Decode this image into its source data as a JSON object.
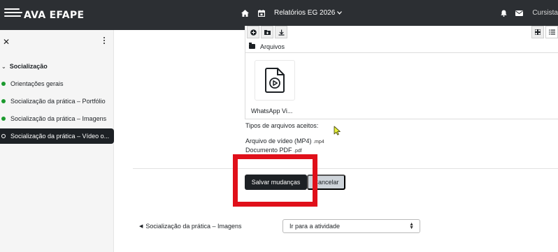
{
  "navbar": {
    "brand": "AVA EFAPE",
    "menu_label": "Relatórios EG 2026",
    "user_label": "Cursista"
  },
  "sidebar": {
    "section_title": "Socialização",
    "items": [
      {
        "label": "Orientações gerais",
        "active": false
      },
      {
        "label": "Socialização da prática – Portfólio",
        "active": false
      },
      {
        "label": "Socialização da prática – Imagens",
        "active": false
      },
      {
        "label": "Socialização da prática – Vídeo o...",
        "active": true
      }
    ]
  },
  "filepicker": {
    "path": "Arquivos",
    "file_name": "WhatsApp Vi..."
  },
  "accepted": {
    "title": "Tipos de arquivos aceitos:",
    "types": [
      {
        "name": "Arquivo de vídeo (MP4)",
        "ext": ".mp4"
      },
      {
        "name": "Documento PDF",
        "ext": ".pdf"
      }
    ]
  },
  "buttons": {
    "save": "Salvar mudanças",
    "cancel": "Cancelar"
  },
  "footer_nav": {
    "prev_link": "Socialização da prática – Imagens",
    "jump_select": "Ir para a atividade"
  },
  "colors": {
    "navbar": "#2c2f33",
    "dark": "#1d2125",
    "complete_dot": "#1b9a2e",
    "highlight": "#e0101a"
  }
}
